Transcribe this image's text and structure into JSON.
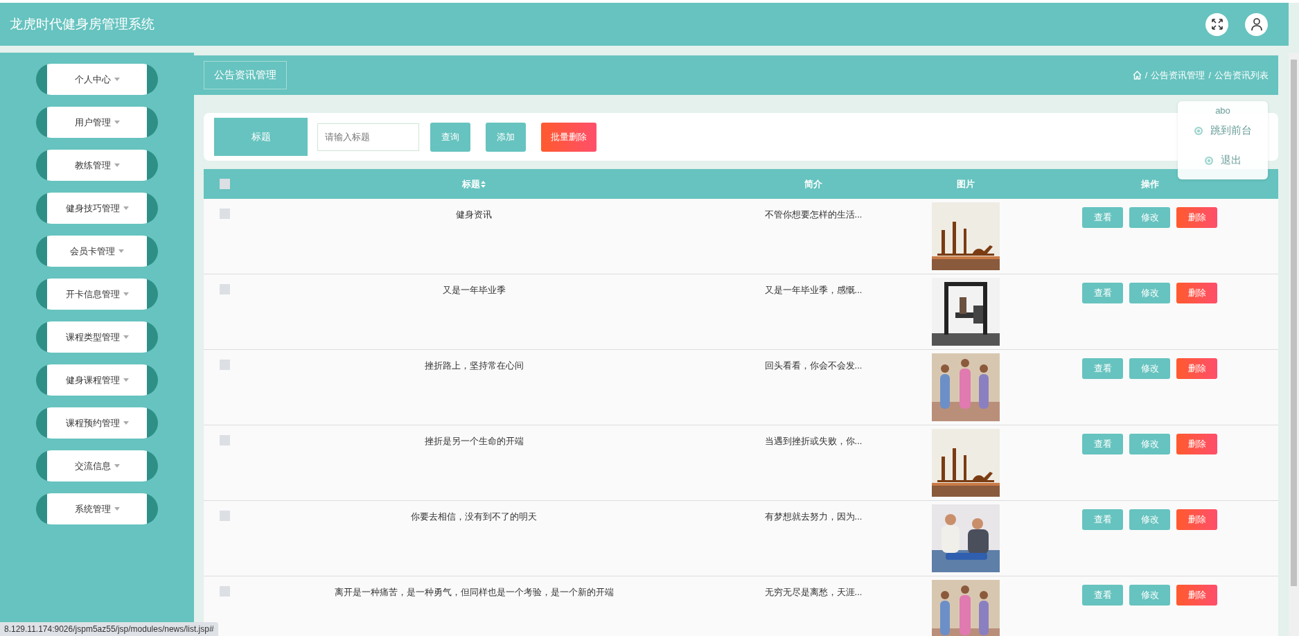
{
  "app": {
    "title": "龙虎时代健身房管理系统"
  },
  "user_menu": {
    "username": "abo",
    "items": [
      "跳到前台",
      "退出"
    ]
  },
  "sidebar": {
    "items": [
      {
        "label": "个人中心"
      },
      {
        "label": "用户管理"
      },
      {
        "label": "教练管理"
      },
      {
        "label": "健身技巧管理"
      },
      {
        "label": "会员卡管理"
      },
      {
        "label": "开卡信息管理"
      },
      {
        "label": "课程类型管理"
      },
      {
        "label": "健身课程管理"
      },
      {
        "label": "课程预约管理"
      },
      {
        "label": "交流信息"
      },
      {
        "label": "系统管理"
      }
    ]
  },
  "breadcrumb": {
    "section": "公告资讯管理",
    "separator": "/",
    "trail": [
      "公告资讯管理",
      "公告资讯列表"
    ]
  },
  "search": {
    "label": "标题",
    "placeholder": "请输入标题",
    "buttons": [
      {
        "label": "查询",
        "kind": "primary"
      },
      {
        "label": "添加",
        "kind": "primary"
      },
      {
        "label": "批量删除",
        "kind": "danger"
      }
    ]
  },
  "table": {
    "select_all_checked": false,
    "columns": [
      "标题",
      "简介",
      "图片",
      "操作"
    ],
    "rows": [
      {
        "checked": false,
        "title": "健身资讯",
        "summary": "不管你想要怎样的生活...",
        "actions": [
          {
            "label": "查看",
            "kind": "primary"
          },
          {
            "label": "修改",
            "kind": "primary"
          },
          {
            "label": "删除",
            "kind": "danger"
          }
        ]
      },
      {
        "checked": false,
        "title": "又是一年毕业季",
        "summary": "又是一年毕业季，感慨...",
        "actions": [
          {
            "label": "查看",
            "kind": "primary"
          },
          {
            "label": "修改",
            "kind": "primary"
          },
          {
            "label": "删除",
            "kind": "danger"
          }
        ]
      },
      {
        "checked": false,
        "title": "挫折路上，坚持常在心间",
        "summary": "回头看看，你会不会发...",
        "actions": [
          {
            "label": "查看",
            "kind": "primary"
          },
          {
            "label": "修改",
            "kind": "primary"
          },
          {
            "label": "删除",
            "kind": "danger"
          }
        ]
      },
      {
        "checked": false,
        "title": "挫折是另一个生命的开端",
        "summary": "当遇到挫折或失败，你...",
        "actions": [
          {
            "label": "查看",
            "kind": "primary"
          },
          {
            "label": "修改",
            "kind": "primary"
          },
          {
            "label": "删除",
            "kind": "danger"
          }
        ]
      },
      {
        "checked": false,
        "title": "你要去相信，没有到不了的明天",
        "summary": "有梦想就去努力，因为...",
        "actions": [
          {
            "label": "查看",
            "kind": "primary"
          },
          {
            "label": "修改",
            "kind": "primary"
          },
          {
            "label": "删除",
            "kind": "danger"
          }
        ]
      },
      {
        "checked": false,
        "title": "离开是一种痛苦，是一种勇气，但同样也是一个考验，是一个新的开端",
        "summary": "无穷无尽是离愁，天涯...",
        "actions": [
          {
            "label": "查看",
            "kind": "primary"
          },
          {
            "label": "修改",
            "kind": "primary"
          },
          {
            "label": "删除",
            "kind": "danger"
          }
        ]
      }
    ]
  },
  "status_bar": {
    "url": "8.129.11.174:9026/jspm5az55/jsp/modules/news/list.jsp#"
  }
}
